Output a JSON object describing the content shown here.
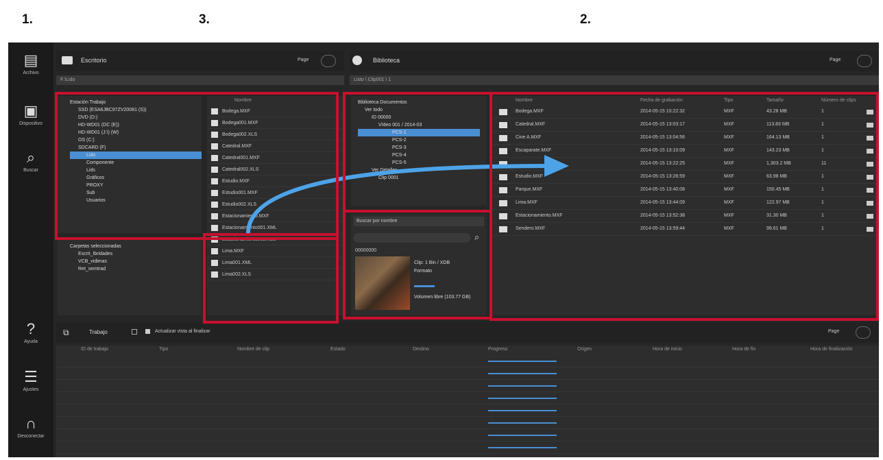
{
  "callouts": [
    "1.",
    "3.",
    "2."
  ],
  "sidebar": {
    "items": [
      {
        "label": "Archivo",
        "icon": "file-icon"
      },
      {
        "label": "Dispositivo",
        "icon": "drive-icon"
      },
      {
        "label": "Buscar",
        "icon": "search-icon"
      },
      {
        "label": "Ayuda",
        "icon": "help-icon"
      },
      {
        "label": "Ajustes",
        "icon": "toolbox-icon"
      },
      {
        "label": "Desconectar",
        "icon": "plug-icon"
      }
    ]
  },
  "left_panel": {
    "title": "Escritorio",
    "page_btn": "Page",
    "path": "F:\\Lido",
    "tree_items": [
      "Estación Trabajo",
      "SSD (ESA6JBC97ZV20081 (S))",
      "DVD (D:)",
      "HD-WD01 (DC (E))",
      "HD-WD01 (J:\\) (W)",
      "OS (C:)",
      "SDCARD (F)",
      "Lido",
      "Componente",
      "Lids",
      "Gráficos",
      "PROXY",
      "Sub",
      "Usuarios"
    ],
    "bottom_tree": [
      "Carpetas seleccionadas",
      "Escrit_Ibridades",
      "VCB_vidimas",
      "Ret_semtrad"
    ],
    "file_list_header": "Nombre",
    "files": [
      "Bodega.MXF",
      "Bodega001.MXF",
      "Bodega002.XLS",
      "Catedral.MXF",
      "Catedral001.MXF",
      "Catedral002.XLS",
      "Estudio.MXF",
      "Estudio001.MXF",
      "Estudio002.XLS",
      "Estacionamiento.MXF",
      "Estacionamiento001.XML",
      "Estacionamiento002.XLS",
      "Lima.MXF",
      "Lima001.XML",
      "Lima002.XLS"
    ]
  },
  "right_panel": {
    "title": "Biblioteca",
    "page_btn": "Page",
    "path": "Listo \\ Clip001 \\ 1",
    "tree_items": [
      "Biblioteca Documentos",
      "Ver todo",
      "ID 00000",
      "Vídeo 001 / 2014-03",
      "PCS-1",
      "PCS-2",
      "PCS-3",
      "PCS-4",
      "PCS-5",
      "Ver Detalles",
      "Clip 0001"
    ],
    "search_label": "Buscar por nombre",
    "clip_id": "00000000",
    "clip_info": "Clip: 1 Bin / XDB",
    "clip_format": "Formato",
    "clip_size": "Volumen libre (103.77 GB)",
    "columns": [
      "Nombre",
      "Fecha de grabación",
      "Tipo",
      "Tamaño",
      "Número de clips"
    ],
    "rows": [
      {
        "name": "Bodega.MXF",
        "date": "2014-05-15 10:22:32",
        "type": "MXF",
        "size": "43.28 MB",
        "count": "1"
      },
      {
        "name": "Catedral.MXF",
        "date": "2014-05-15 13:03:17",
        "type": "MXF",
        "size": "113.83 MB",
        "count": "1"
      },
      {
        "name": "Cine A.MXF",
        "date": "2014-05-15 13:04:56",
        "type": "MXF",
        "size": "164.13 MB",
        "count": "1"
      },
      {
        "name": "Escaparate.MXF",
        "date": "2014-05-15 13:10:09",
        "type": "MXF",
        "size": "143.23 MB",
        "count": "1"
      },
      {
        "name": "",
        "date": "2014-05-15 13:22:25",
        "type": "MXF",
        "size": "1,303.2 MB",
        "count": "11"
      },
      {
        "name": "Estudio.MXF",
        "date": "2014-05-15 13:26:59",
        "type": "MXF",
        "size": "63.98 MB",
        "count": "1"
      },
      {
        "name": "Parque.MXF",
        "date": "2014-05-15 13:40:08",
        "type": "MXF",
        "size": "150.45 MB",
        "count": "1"
      },
      {
        "name": "Lima.MXF",
        "date": "2014-05-15 13:44:09",
        "type": "MXF",
        "size": "122.97 MB",
        "count": "1"
      },
      {
        "name": "Estacionamiento.MXF",
        "date": "2014-05-15 13:52:38",
        "type": "MXF",
        "size": "31.30 MB",
        "count": "1"
      },
      {
        "name": "Sendero.MXF",
        "date": "2014-05-15 13:59:44",
        "type": "MXF",
        "size": "99.61 MB",
        "count": "1"
      }
    ]
  },
  "jobs": {
    "title": "Trabajo",
    "auto_label": "Actualizar vista al finalizar",
    "page_btn": "Page",
    "columns": [
      "ID de trabajo",
      "Tipo",
      "Nombre de clip",
      "Estado",
      "Destino",
      "Progreso",
      "Origen",
      "Hora de inicio",
      "Hora de fin",
      "Hora de finalización"
    ],
    "rows": [
      {
        "progress": 1.0
      },
      {
        "progress": 1.0
      },
      {
        "progress": 1.0
      },
      {
        "progress": 1.0
      },
      {
        "progress": 1.0
      },
      {
        "progress": 1.0
      },
      {
        "progress": 1.0
      },
      {
        "progress": 1.0
      }
    ]
  },
  "colors": {
    "accent": "#4a8fd4",
    "highlight": "#c8102e",
    "arrow": "#4da3e8"
  }
}
